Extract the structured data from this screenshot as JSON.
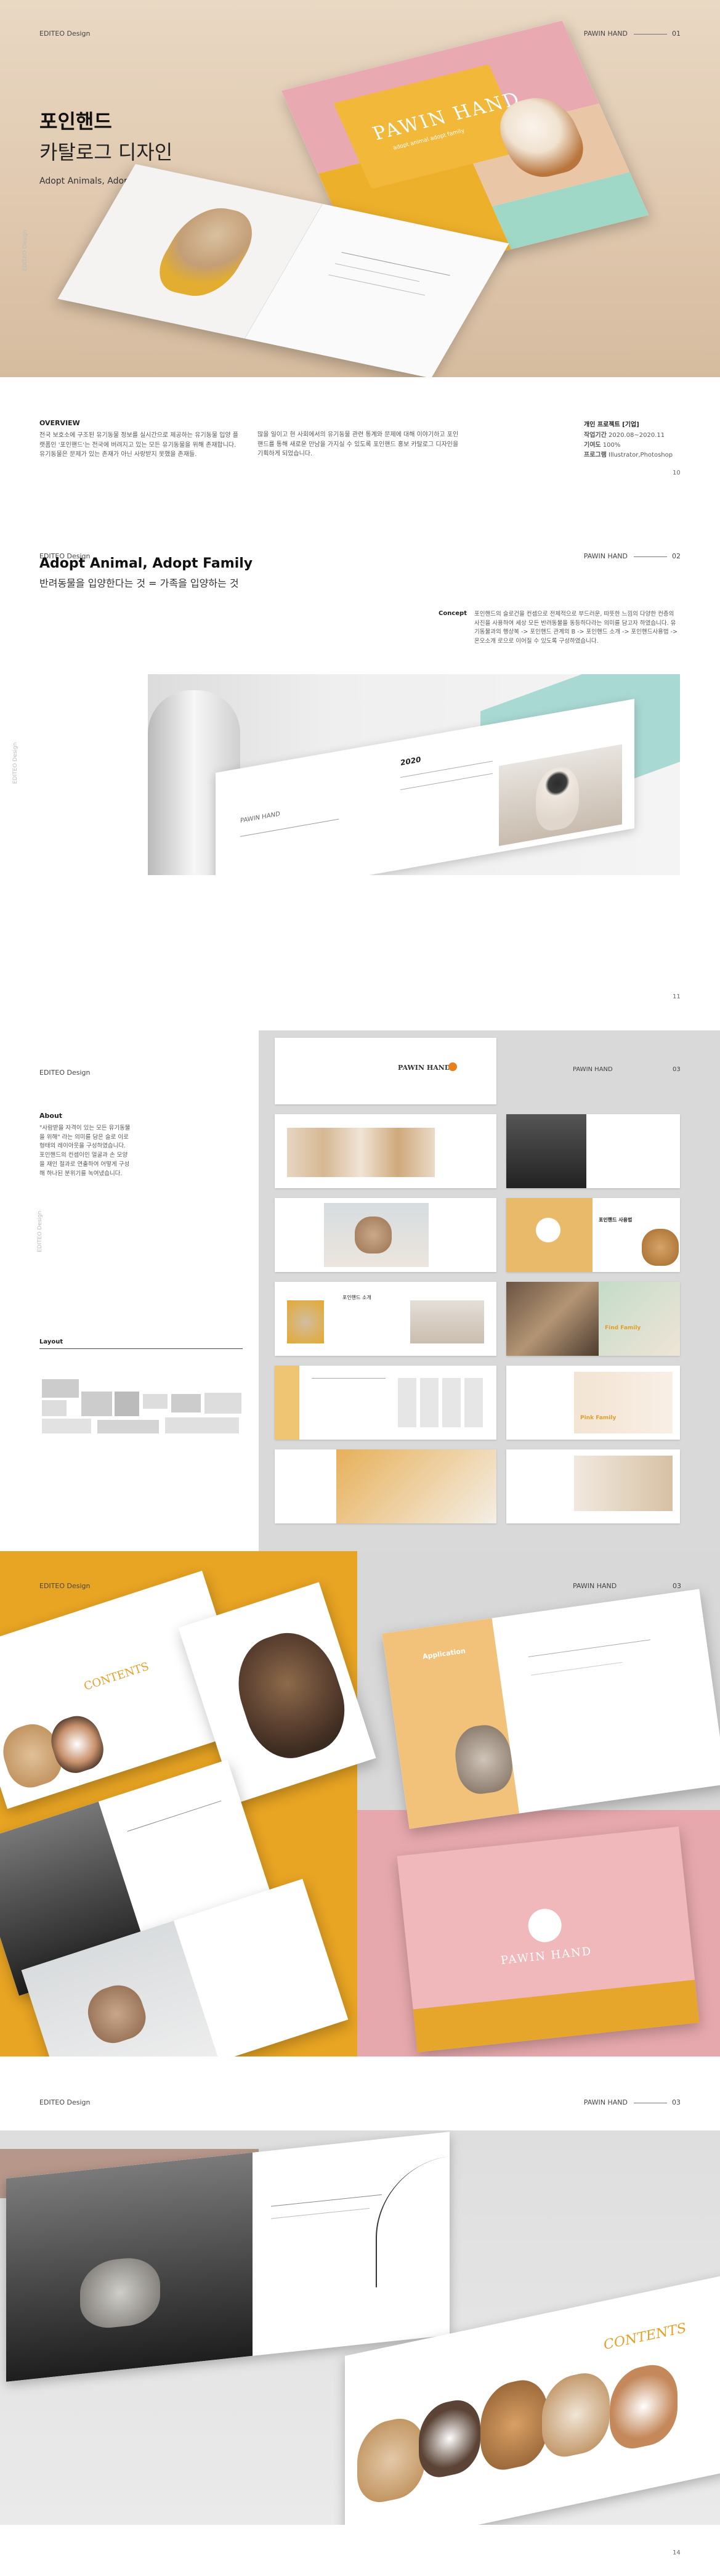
{
  "header": {
    "left": "EDITEO Design",
    "brand": "PAWIN HAND",
    "first_page_num": "01",
    "second_page_num": "02",
    "third_page_num": "03"
  },
  "hero": {
    "title": "포인핸드",
    "subtitle": "카탈로그 디자인",
    "tagline": "Adopt Animals, Adopt Family",
    "side_text": "EDITEO Design",
    "cover_brand": "PAWIN HAND",
    "cover_tag": "adopt animal adopt family"
  },
  "overview": {
    "heading": "OVERVIEW",
    "col1": "전국 보호소에 구조된 유기동물 정보를 실시간으로 제공하는 유기동물 입양 플랫폼인 '포인핸드'는 전국에 버려지고 있는 모든 유기동물을 위해 존재합니다. 유기동물은 문제가 있는 존재가 아닌 사랑받지 못했을 존재들.",
    "col2": "많을 일이고 현 사회에서의 유기동물 관련 통계와 문제에 대해 이야기하고 포인핸드를 통해 새로운 만남을 가지실 수 있도록 포인핸드 홍보 카탈로그 디자인을 기획하게 되었습니다.",
    "meta_title": "개인 프로젝트 [기업]",
    "meta": [
      {
        "k": "작업기간",
        "v": "2020.08~2020.11"
      },
      {
        "k": "기여도",
        "v": "100%"
      },
      {
        "k": "프로그램",
        "v": "Illustrator,Photoshop"
      }
    ],
    "page": "10"
  },
  "concept_section": {
    "title": "Adopt Animal, Adopt Family",
    "subtitle": "반려동물을 입양한다는 것 = 가족을 입양하는 것",
    "concept_label": "Concept",
    "concept_text": "포인핸드의 슬로건을 컨셉으로 전체적으로 부드러운, 따뜻한 느낌의 다양한 컨층의 사진을 사용하여 세상 모든 반려동물을 동등하다라는 의미를 담고자 하였습니다. 유기동물과의 행상복 -> 포인핸드 관계의 B -> 포인핸드 소개 -> 포인핸드사용법 -> 온오소개 로으로 이어질 수 있도록 구성하였습니다.",
    "side_text": "EDITEO Design",
    "spread_heading": "2020",
    "spread_label": "PAWIN HAND",
    "page": "11"
  },
  "layout_section": {
    "about_label": "About",
    "about_text": "\"사람받을 자격이 있는 모든 유기동물을 위해\" 라는 의미를 담은 슬로 이로형태의 레이아웃을 구성하였습니다. 포인핸드의 컨셉이인 얼굴과 손 모양을 재인 절과로 연출하여 어떻게 구성해 하나된 분위기를 녹여냈습니다.",
    "layout_label": "Layout",
    "side_text": "EDITEO Design",
    "brand_logo": "PAWIN HAND",
    "blocks": [
      {
        "title": "",
        "text": "포인핸드 소개"
      },
      {
        "title": "포인핸드 사용법",
        "text": "application"
      },
      {
        "title": "Find Family",
        "text": "Pink Family"
      }
    ]
  },
  "mockups_section": {
    "header_left": "EDITEO Design",
    "cover_brand": "PAWIN HAND",
    "contents_label": "CONTENTS",
    "application_label": "Application",
    "page_num": "03"
  },
  "final_section": {
    "contents_label": "CONTENTS",
    "page": "14"
  }
}
